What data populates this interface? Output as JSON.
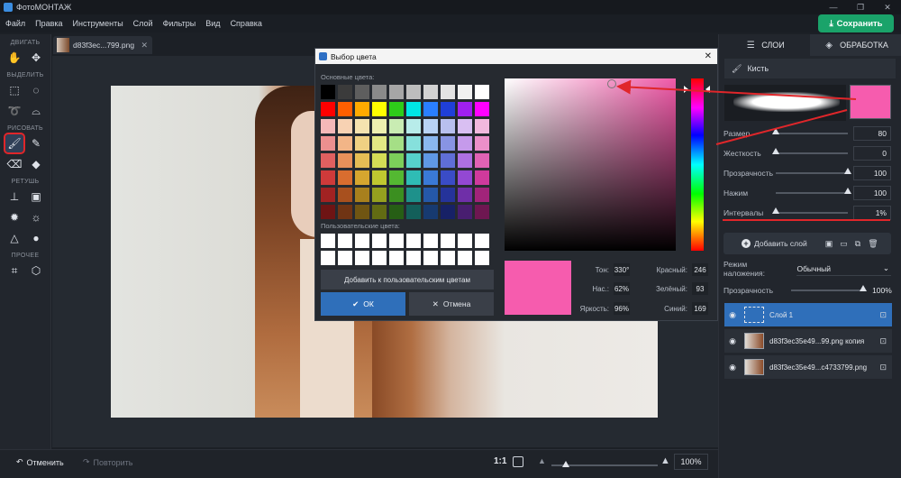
{
  "app": {
    "title": "ФотоМОНТАЖ",
    "save_label": "Сохранить"
  },
  "window": {
    "minimize": "—",
    "maximize": "❐",
    "close": "✕"
  },
  "menu": [
    "Файл",
    "Правка",
    "Инструменты",
    "Слой",
    "Фильтры",
    "Вид",
    "Справка"
  ],
  "toolbar": {
    "sections": [
      "ДВИГАТЬ",
      "ВЫДЕЛИТЬ",
      "РИСОВАТЬ",
      "РЕТУШЬ",
      "ПРОЧЕЕ"
    ]
  },
  "document": {
    "tab_name": "d83f3ec...799.png",
    "close": "✕"
  },
  "bottom": {
    "undo": "Отменить",
    "redo": "Повторить",
    "zoom_11": "1:1",
    "zoom_percent": "100%",
    "zoom_level": 0.1
  },
  "right_panel": {
    "tab_layers": "СЛОИ",
    "tab_processing": "ОБРАБОТКА",
    "brush_title": "Кисть",
    "brush_color": "#f65cae",
    "params": [
      {
        "label": "Размер",
        "value": "80",
        "level": 0.0
      },
      {
        "label": "Жесткость",
        "value": "0",
        "level": 0.0
      },
      {
        "label": "Прозрачность",
        "value": "100",
        "level": 1.0
      },
      {
        "label": "Нажим",
        "value": "100",
        "level": 1.0
      },
      {
        "label": "Интервалы",
        "value": "1%",
        "level": 0.0
      }
    ],
    "add_layer": "Добавить слой",
    "blend_label": "Режим наложения:",
    "blend_value": "Обычный",
    "opacity_label": "Прозрачность",
    "opacity_value": "100%",
    "layers": [
      {
        "name": "Слой 1",
        "selected": true
      },
      {
        "name": "d83f3ec35e49...99.png копия",
        "selected": false
      },
      {
        "name": "d83f3ec35e49...c4733799.png",
        "selected": false
      }
    ]
  },
  "dialog": {
    "title": "Выбор цвета",
    "basic_label": "Основные цвета:",
    "custom_label": "Пользовательские цвета:",
    "add_custom": "Добавить к пользовательским цветам",
    "ok": "ОК",
    "cancel": "Отмена",
    "hue_label": "Тон:",
    "hue": "330°",
    "sat_label": "Нас.:",
    "sat": "62%",
    "bri_label": "Яркость:",
    "bri": "96%",
    "red_label": "Красный:",
    "red": "246",
    "green_label": "Зелёный:",
    "green": "93",
    "blue_label": "Синий:",
    "blue": "169",
    "selected_color": "#f65cae",
    "basic_colors": [
      "#000000",
      "#3b3b3b",
      "#5e5e5e",
      "#8a8a8a",
      "#a6a6a6",
      "#bdbdbd",
      "#d2d2d2",
      "#e3e3e3",
      "#f1f1f1",
      "#ffffff",
      "#ff0000",
      "#ff5f00",
      "#ffaa00",
      "#ffff00",
      "#2ecc1a",
      "#00e5e5",
      "#2a7fff",
      "#1f3fd8",
      "#a020f0",
      "#ff00ff",
      "#f4b8b8",
      "#f7d2b3",
      "#f5e3b0",
      "#eef0b0",
      "#c9ecb3",
      "#b8ecea",
      "#b8d3f5",
      "#b8c0ee",
      "#d9bff2",
      "#f2b8dd",
      "#ec8f8f",
      "#f2b587",
      "#efd183",
      "#e2e884",
      "#a5df86",
      "#86e0dc",
      "#8ab7ee",
      "#8894e3",
      "#c59aeb",
      "#eb8fc9",
      "#e06060",
      "#e8915a",
      "#e5bd55",
      "#d4dc56",
      "#7cce5a",
      "#56d1cc",
      "#5f98e4",
      "#5f6ed7",
      "#ad70e2",
      "#e062b4",
      "#cf3a3a",
      "#d96d2f",
      "#d6a62f",
      "#bfc830",
      "#54b832",
      "#2fbcb5",
      "#3a79d6",
      "#3a4cc6",
      "#9348d3",
      "#cf3a9c",
      "#a12222",
      "#a8501e",
      "#a8801d",
      "#95a01f",
      "#3b8f20",
      "#1e918b",
      "#2558a8",
      "#25339a",
      "#6f2fa8",
      "#a1247a",
      "#6e1414",
      "#703414",
      "#705512",
      "#626b13",
      "#265e15",
      "#135f5a",
      "#173a70",
      "#172166",
      "#481e70",
      "#6e1751"
    ]
  }
}
